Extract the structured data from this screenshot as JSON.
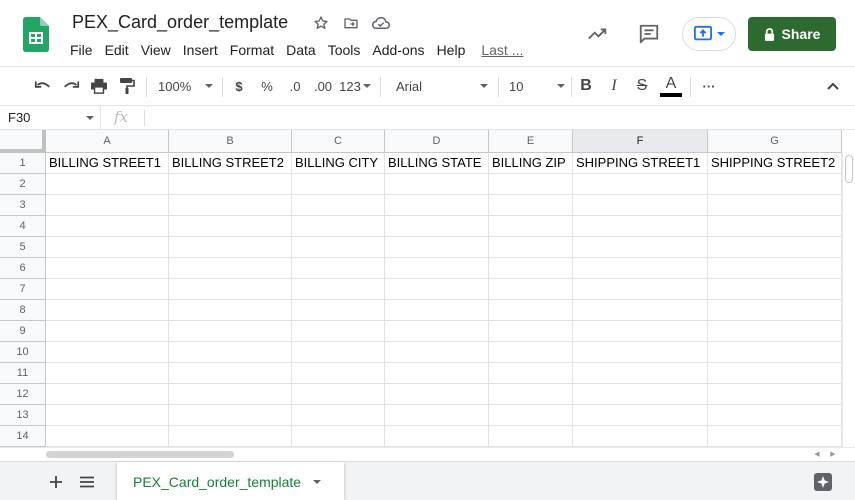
{
  "doc": {
    "title": "PEX_Card_order_template"
  },
  "menu": [
    "File",
    "Edit",
    "View",
    "Insert",
    "Format",
    "Data",
    "Tools",
    "Add-ons",
    "Help"
  ],
  "last_edit": "Last ...",
  "share": {
    "label": "Share"
  },
  "toolbar": {
    "zoom": "100%",
    "currency": "$",
    "percent": "%",
    "decrease_decimals": ".0",
    "increase_decimals": ".00",
    "more_formats": "123",
    "font": "Arial",
    "font_size": "10",
    "bold": "B",
    "italic": "I",
    "strikethrough": "S",
    "text_color_letter": "A",
    "more": "···"
  },
  "formula_bar": {
    "cell_ref": "F30",
    "fx": "fx",
    "value": ""
  },
  "grid": {
    "selected_column": "F",
    "columns": [
      {
        "letter": "A",
        "header": "BILLING STREET1"
      },
      {
        "letter": "B",
        "header": "BILLING STREET2"
      },
      {
        "letter": "C",
        "header": "BILLING CITY"
      },
      {
        "letter": "D",
        "header": "BILLING STATE"
      },
      {
        "letter": "E",
        "header": "BILLING ZIP"
      },
      {
        "letter": "F",
        "header": "SHIPPING STREET1"
      },
      {
        "letter": "G",
        "header": "SHIPPING STREET2"
      }
    ],
    "rows": [
      "1",
      "2",
      "3",
      "4",
      "5",
      "6",
      "7",
      "8",
      "9",
      "10",
      "11",
      "12",
      "13",
      "14"
    ]
  },
  "sheets": [
    {
      "name": "PEX_Card_order_template",
      "active": true
    }
  ],
  "colors": {
    "accent_green": "#188038",
    "share_green": "#2d6a2f",
    "present_blue": "#1a73e8",
    "text_color_bar": "#000000"
  },
  "icons": {
    "app": "sheets-logo-icon",
    "star": "star-icon",
    "move": "move-to-folder-icon",
    "cloud": "cloud-saved-icon",
    "trend": "trending-up-icon",
    "comment": "comment-icon",
    "present": "present-icon",
    "lock": "lock-icon",
    "undo": "undo-icon",
    "redo": "redo-icon",
    "print": "print-icon",
    "paint": "paint-format-icon",
    "collapse": "chevron-up-icon",
    "add_sheet": "plus-icon",
    "all_sheets": "list-icon",
    "explore": "explore-icon"
  }
}
